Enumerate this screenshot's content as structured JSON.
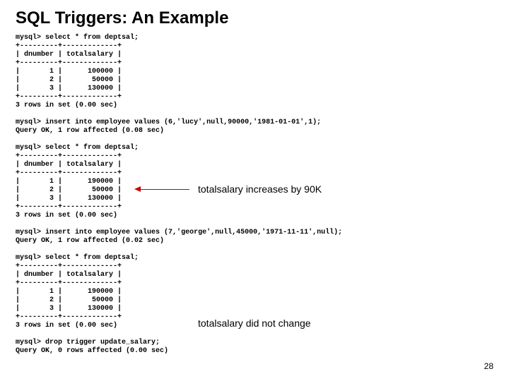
{
  "title": "SQL Triggers: An Example",
  "page_number": "28",
  "annotation1": "totalsalary increases by 90K",
  "annotation2": "totalsalary did not change",
  "console": {
    "prompt": "mysql>",
    "select_cmd": "select * from deptsal;",
    "insert_cmd1": "insert into employee values (6,'lucy',null,90000,'1981-01-01',1);",
    "insert_result1": "Query OK, 1 row affected (0.08 sec)",
    "insert_cmd2": "insert into employee values (7,'george',null,45000,'1971-11-11',null);",
    "insert_result2": "Query OK, 1 row affected (0.02 sec)",
    "drop_cmd": "drop trigger update_salary;",
    "drop_result": "Query OK, 0 rows affected (0.00 sec)",
    "rows_msg": "3 rows in set (0.00 sec)",
    "table_border": "+---------+-------------+",
    "table_header": "| dnumber | totalsalary |",
    "t1r1": "|       1 |      100000 |",
    "t1r2": "|       2 |       50000 |",
    "t1r3": "|       3 |      130000 |",
    "t2r1": "|       1 |      190000 |",
    "t2r2": "|       2 |       50000 |",
    "t2r3": "|       3 |      130000 |",
    "t3r1": "|       1 |      190000 |",
    "t3r2": "|       2 |       50000 |",
    "t3r3": "|       3 |      130000 |"
  }
}
